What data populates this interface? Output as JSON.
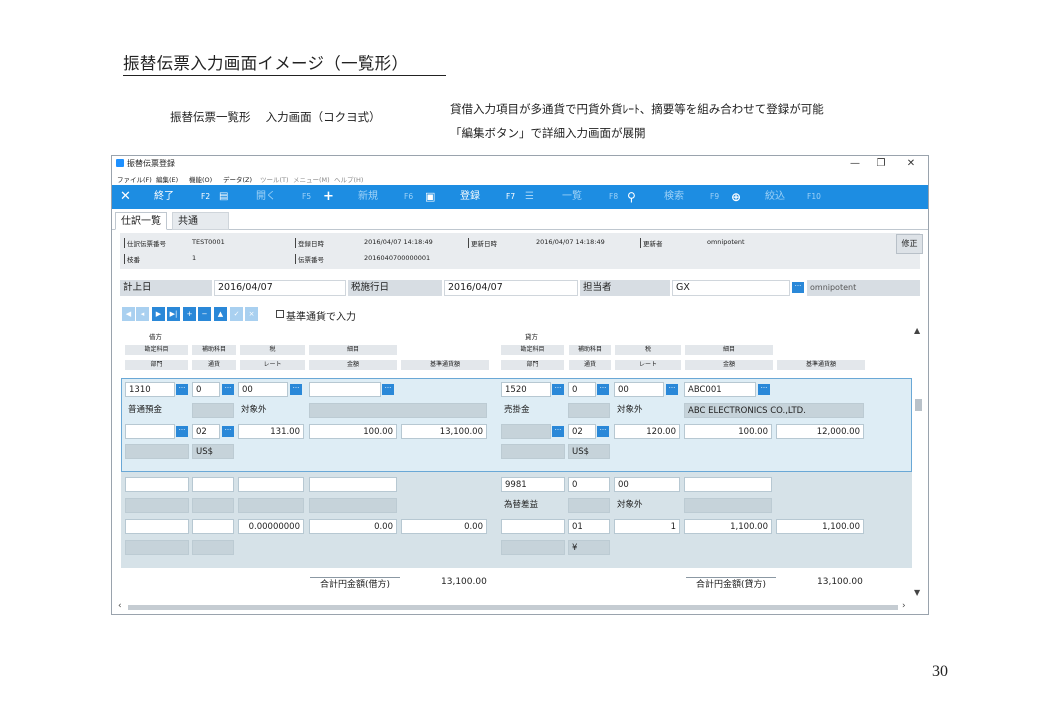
{
  "slide": {
    "title": "振替伝票入力画面イメージ（一覧形）",
    "subtitle": "振替伝票一覧形　 入力画面（コクヨ式）",
    "desc_line1": "貸借入力項目が多通貨で円貨外貨ﾚｰﾄ、摘要等を組み合わせて登録が可能",
    "desc_line2": "「編集ボタン」で詳細入力画面が展開",
    "page_number": "30"
  },
  "window": {
    "title": "振替伝票登録",
    "controls": {
      "minimize": "—",
      "restore": "❐",
      "close": "✕"
    }
  },
  "menu": [
    "ファイル(F)",
    "編集(E)",
    "機能(O)",
    "データ(Z)",
    "ツール(T)",
    "メニュー(M)",
    "ヘルプ(H)"
  ],
  "toolbar": {
    "exit_label": "終了",
    "exit_key": "F2",
    "open_label": "開く",
    "open_key": "F5",
    "new_label": "新規",
    "new_key": "F6",
    "register_label": "登録",
    "register_key": "F7",
    "list_label": "一覧",
    "list_key": "F8",
    "search_label": "検索",
    "search_key": "F9",
    "filter_label": "絞込",
    "filter_key": "F10"
  },
  "tabs": {
    "journal_list": "仕訳一覧",
    "common": "共通"
  },
  "info": {
    "voucher_no_label": "仕訳伝票番号",
    "voucher_no": "TEST0001",
    "branch_label": "枝番",
    "branch": "1",
    "created_label": "登録日時",
    "created": "2016/04/07  14:18:49",
    "slip_no_label": "伝票番号",
    "slip_no": "2016040700000001",
    "updated_label": "更新日時",
    "updated": "2016/04/07  14:18:49",
    "updater_label": "更新者",
    "updater": "omnipotent",
    "correct_button": "修正"
  },
  "header_fields": {
    "posting_date_label": "計上日",
    "posting_date": "2016/04/07",
    "tax_date_label": "税施行日",
    "tax_date": "2016/04/07",
    "person_label": "担当者",
    "person_code": "GX",
    "person_name": "omnipotent"
  },
  "nav": {
    "base_currency_label": "基準通貨で入力"
  },
  "columns": {
    "debit_title": "借方",
    "credit_title": "貸方",
    "debit_row1": [
      "勘定科目",
      "補助科目",
      "税",
      "細目"
    ],
    "debit_row2": [
      "部門",
      "通貨",
      "レート",
      "金額",
      "基準通貨額"
    ],
    "credit_row1": [
      "勘定科目",
      "補助科目",
      "税",
      "細目"
    ],
    "credit_row2": [
      "部門",
      "通貨",
      "レート",
      "金額",
      "基準通貨額"
    ]
  },
  "rows": [
    {
      "debit": {
        "account_code": "1310",
        "sub_account": "0",
        "tax": "00",
        "detail": "",
        "account_name": "普通預金",
        "tax_name": "対象外",
        "currency": "02",
        "rate": "131.00",
        "amount": "100.00",
        "base_amount": "13,100.00",
        "currency_name": "US$"
      },
      "credit": {
        "account_code": "1520",
        "sub_account": "0",
        "tax": "00",
        "detail": "ABC001",
        "account_name": "売掛金",
        "tax_name": "対象外",
        "detail_name": "ABC ELECTRONICS CO.,LTD.",
        "currency": "02",
        "rate": "120.00",
        "amount": "100.00",
        "base_amount": "12,000.00",
        "currency_name": "US$"
      }
    },
    {
      "debit": {
        "rate": "0.00000000",
        "amount": "0.00",
        "base_amount": "0.00"
      },
      "credit": {
        "account_code": "9981",
        "sub_account": "0",
        "tax": "00",
        "account_name": "為替差益",
        "tax_name": "対象外",
        "currency": "01",
        "rate": "1",
        "amount": "1,100.00",
        "base_amount": "1,100.00",
        "currency_name": "¥"
      }
    }
  ],
  "totals": {
    "debit_label": "合計円金額(借方)",
    "debit_total": "13,100.00",
    "credit_label": "合計円金額(貸方)",
    "credit_total": "13,100.00"
  },
  "colors": {
    "toolbar": "#1d8de2",
    "button_blue": "#2a88d8",
    "grid_bg": "#d6e2e8",
    "selected_row_border": "#6aa8d6"
  }
}
